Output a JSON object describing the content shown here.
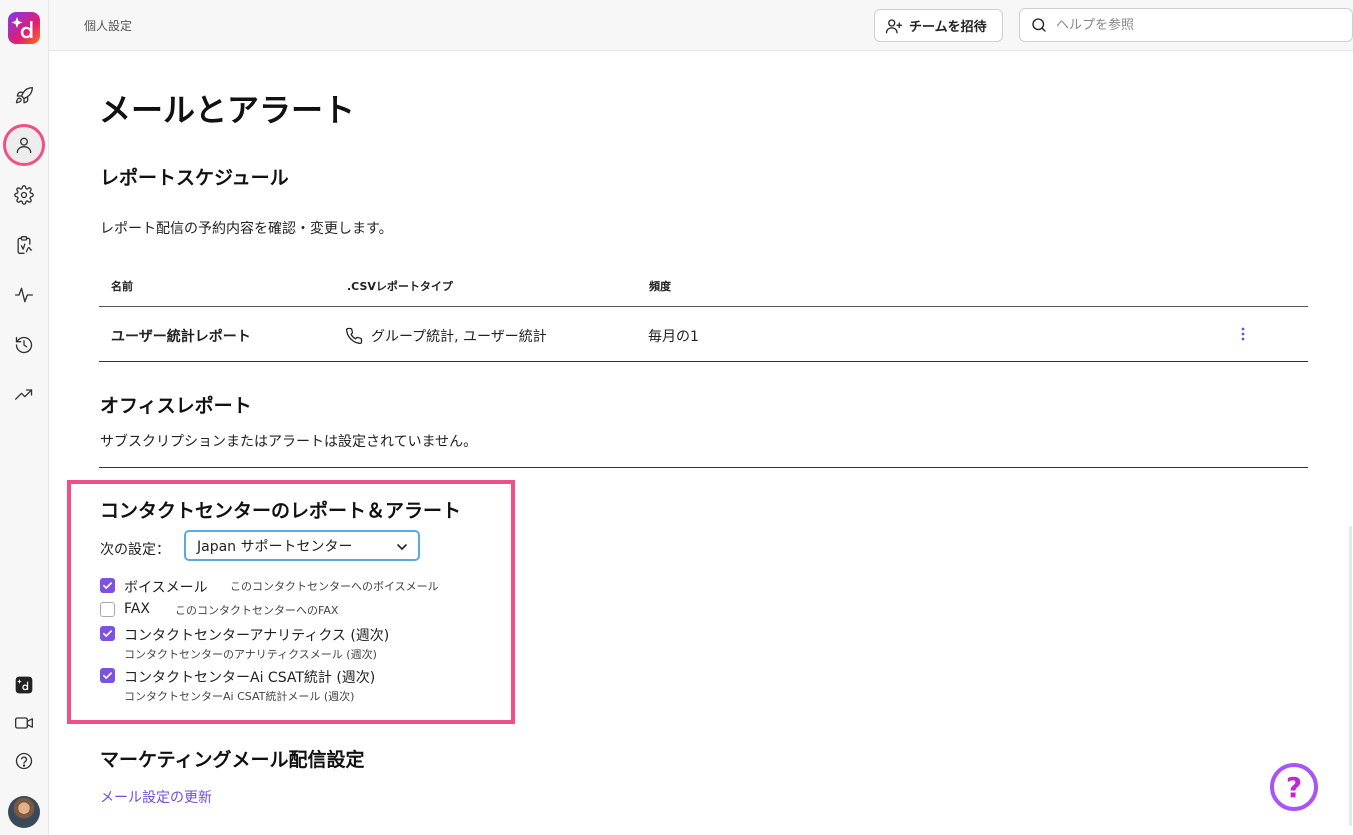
{
  "topbar": {
    "breadcrumb": "個人設定",
    "invite_label": "チームを招待",
    "search_placeholder": "ヘルプを参照"
  },
  "rail": {
    "icons": [
      "rocket-icon",
      "person-icon",
      "gear-icon",
      "clipboard-icon",
      "activity-icon",
      "history-icon",
      "trending-icon",
      "brand-icon",
      "video-icon",
      "help-circle-icon"
    ]
  },
  "page": {
    "title": "メールとアラート"
  },
  "report_schedule": {
    "heading": "レポートスケジュール",
    "description": "レポート配信の予約内容を確認・変更します。",
    "columns": [
      "名前",
      ".CSVレポートタイプ",
      "頻度"
    ],
    "rows": [
      {
        "name": "ユーザー統計レポート",
        "type": "グループ統計, ユーザー統計",
        "frequency": "毎月の1"
      }
    ]
  },
  "office_report": {
    "heading": "オフィスレポート",
    "empty_text": "サブスクリプションまたはアラートは設定されていません。"
  },
  "contact_center": {
    "heading": "コンタクトセンターのレポート＆アラート",
    "select_label": "次の設定：",
    "select_value": "Japan サポートセンター",
    "options": [
      {
        "label": "ボイスメール",
        "note": "このコンタクトセンターへのボイスメール",
        "checked": true
      },
      {
        "label": "FAX",
        "note": "このコンタクトセンターへのFAX",
        "checked": false
      },
      {
        "label": "コンタクトセンターアナリティクス (週次)",
        "note": "コンタクトセンターのアナリティクスメール (週次)",
        "checked": true
      },
      {
        "label": "コンタクトセンターAi CSAT統計 (週次)",
        "note": "コンタクトセンターAi CSAT統計メール (週次)",
        "checked": true
      }
    ]
  },
  "marketing": {
    "heading": "マーケティングメール配信設定",
    "link_label": "メール設定の更新"
  },
  "help_fab": "?",
  "colors": {
    "accent": "#7c52e0",
    "highlight": "#f0508a",
    "link": "#6d4fe0"
  }
}
